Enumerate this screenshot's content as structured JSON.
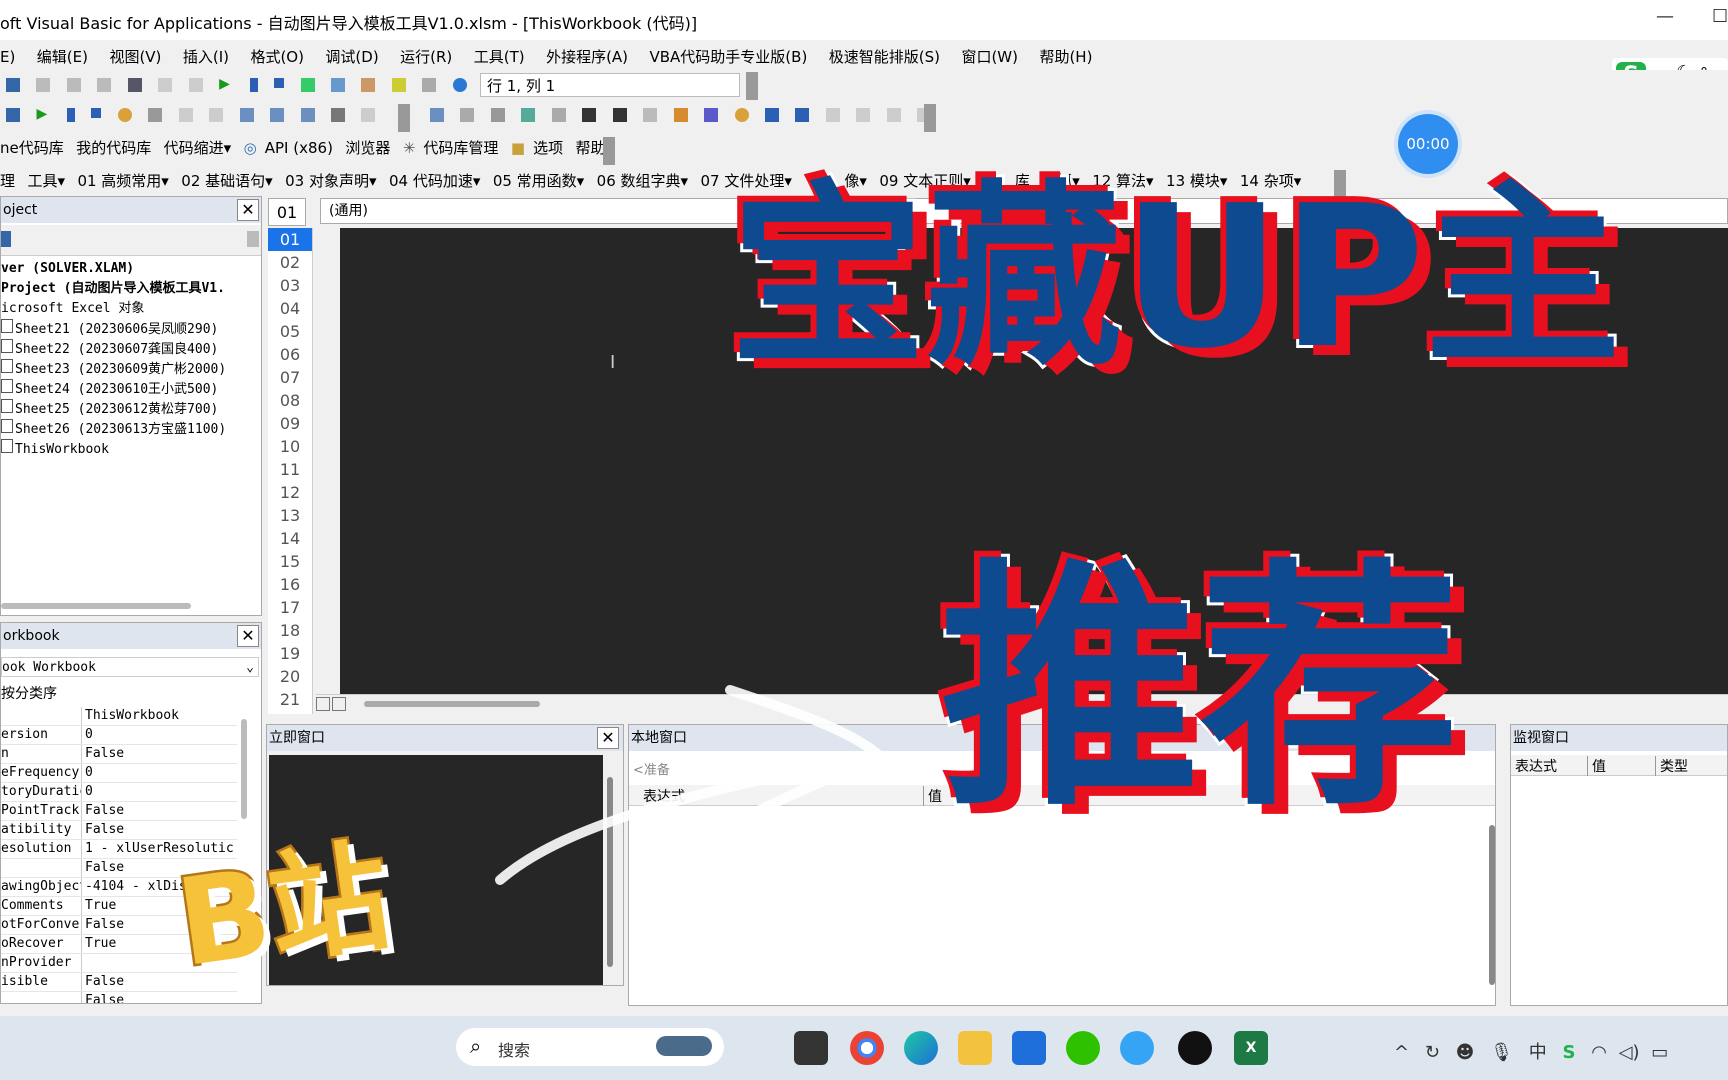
{
  "window": {
    "title": "oft Visual Basic for Applications - 自动图片导入模板工具V1.0.xlsm - [ThisWorkbook (代码)]",
    "minimize_glyph": "—",
    "maximize_glyph": "☐"
  },
  "menu": [
    "E)",
    "编辑(E)",
    "视图(V)",
    "插入(I)",
    "格式(O)",
    "调试(D)",
    "运行(R)",
    "工具(T)",
    "外接程序(A)",
    "VBA代码助手专业版(B)",
    "极速智能排版(S)",
    "窗口(W)",
    "帮助(H)"
  ],
  "toolbar": {
    "position": "行 1, 列 1"
  },
  "toolbar3": [
    "ne代码库",
    "我的代码库",
    "代码缩进▾",
    "API (x86)",
    "浏览器",
    "代码库管理",
    "选项",
    "帮助▾"
  ],
  "toolbar4": [
    "理",
    "工具▾",
    "01 高频常用▾",
    "02 基础语句▾",
    "03 对象声明▾",
    "04 代码加速▾",
    "05 常用函数▾",
    "06 数组字典▾",
    "07 文件处理▾",
    "像▾",
    "09 文本正则▾",
    "10",
    "库",
    "网抓▾",
    "12 算法▾",
    "13 模块▾",
    "14 杂项▾"
  ],
  "ime": {
    "label": "五",
    "symbols": "°,"
  },
  "timer": "00:00",
  "project_pane": {
    "title": "oject",
    "close": "✕",
    "tree": [
      "ver (SOLVER.XLAM)",
      "Project (自动图片导入模板工具V1.",
      "icrosoft Excel 对象",
      "Sheet21 (20230606吴凤顺290)",
      "Sheet22 (20230607龚国良400)",
      "Sheet23 (20230609黄广彬2000)",
      "Sheet24 (20230610王小武500)",
      "Sheet25 (20230612黄松芽700)",
      "Sheet26 (20230613方宝盛1100)",
      "ThisWorkbook"
    ]
  },
  "properties_pane": {
    "title": "orkbook",
    "close": "✕",
    "object_select": "ook Workbook",
    "sort_tab": "按分类序",
    "rows": [
      [
        "",
        "ThisWorkbook"
      ],
      [
        "ersion",
        "0"
      ],
      [
        "n",
        "False"
      ],
      [
        "eFrequency",
        "0"
      ],
      [
        "toryDuratic",
        "0"
      ],
      [
        "PointTrack",
        "False"
      ],
      [
        "atibility",
        "False"
      ],
      [
        "esolution",
        "1 - xlUserResolutic"
      ],
      [
        "",
        "False"
      ],
      [
        "awingObject",
        "-4104 - xlDisplaySh"
      ],
      [
        "Comments",
        "True"
      ],
      [
        "otForConver",
        "False"
      ],
      [
        "oRecover",
        "True"
      ],
      [
        "nProvider",
        ""
      ],
      [
        "isible",
        "False"
      ],
      [
        "",
        "False"
      ]
    ]
  },
  "code_pane": {
    "object_combo": "(通用)",
    "top_no": "01",
    "line_numbers": [
      "01",
      "02",
      "03",
      "04",
      "05",
      "06",
      "07",
      "08",
      "09",
      "10",
      "11",
      "12",
      "13",
      "14",
      "15",
      "16",
      "17",
      "18",
      "19",
      "20",
      "21"
    ]
  },
  "immediate_pane": {
    "title": "立即窗口",
    "close": "✕"
  },
  "locals_pane": {
    "title": "本地窗口",
    "status": "<准备",
    "col_expr": "表达式",
    "col_value": "值"
  },
  "watch_pane": {
    "title": "监视窗口",
    "col_expr": "表达式",
    "col_value": "值",
    "col_type": "类型"
  },
  "overlay": {
    "headline": "宝藏UP主",
    "subline": "推荐",
    "badge": "B站"
  },
  "taskbar": {
    "search_placeholder": "搜索",
    "tray_input": "中"
  },
  "colors": {
    "code_bg": "#262626",
    "overlay_blue": "#0d4a8f",
    "overlay_red": "#e8101e",
    "badge_yellow": "#f6c23a",
    "timer_blue": "#2f8ef0"
  }
}
